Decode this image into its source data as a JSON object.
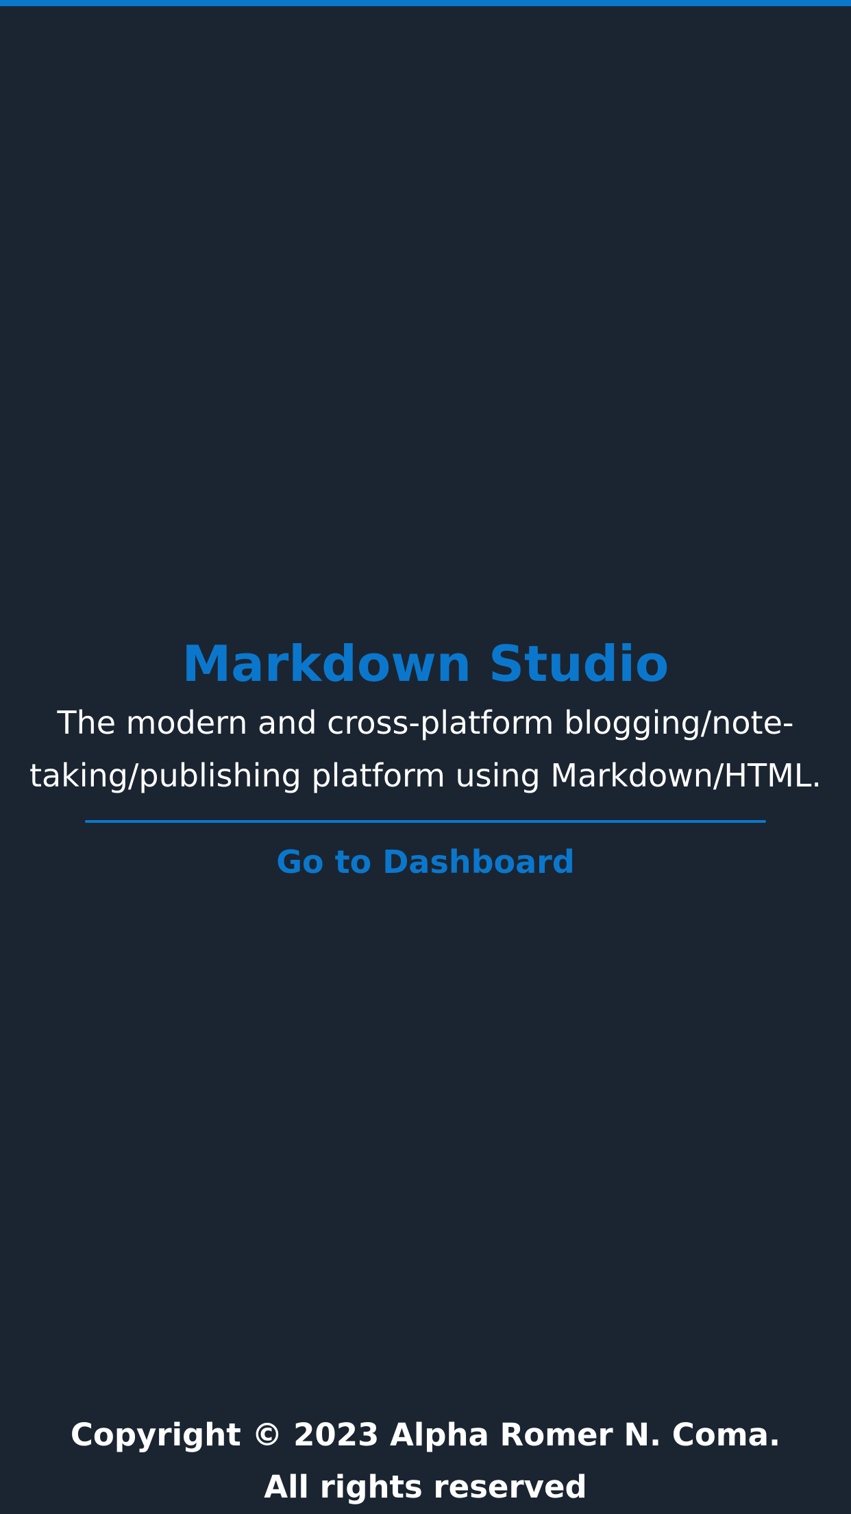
{
  "colors": {
    "background": "#1b2531",
    "accent": "#0b77cc",
    "text": "#ffffff"
  },
  "hero": {
    "title": "Markdown Studio",
    "description_line1": "The modern and cross-platform blogging/note-",
    "description_line2": "taking/publishing platform using Markdown/HTML.",
    "dashboard_link": "Go to Dashboard"
  },
  "footer": {
    "copyright": "Copyright © 2023 Alpha Romer N. Coma.",
    "rights": "All rights reserved"
  }
}
